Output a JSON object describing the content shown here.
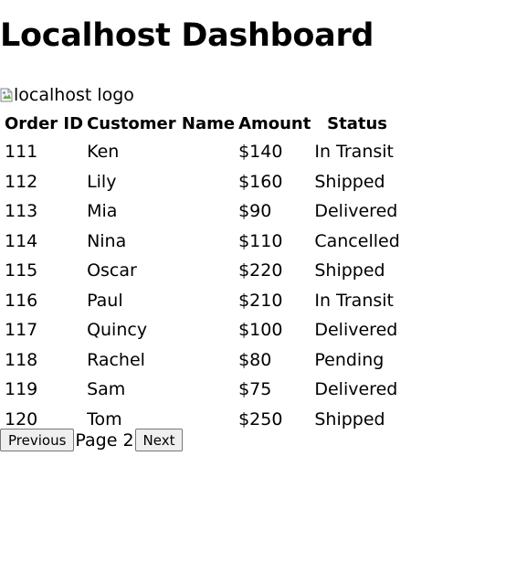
{
  "header": {
    "title": "Localhost Dashboard"
  },
  "logo": {
    "alt": "localhost logo",
    "icon": "broken-image-icon"
  },
  "table": {
    "columns": [
      "Order ID",
      "Customer Name",
      "Amount",
      "Status"
    ],
    "rows": [
      {
        "id": "111",
        "name": "Ken",
        "amount": "$140",
        "status": "In Transit"
      },
      {
        "id": "112",
        "name": "Lily",
        "amount": "$160",
        "status": "Shipped"
      },
      {
        "id": "113",
        "name": "Mia",
        "amount": "$90",
        "status": "Delivered"
      },
      {
        "id": "114",
        "name": "Nina",
        "amount": "$110",
        "status": "Cancelled"
      },
      {
        "id": "115",
        "name": "Oscar",
        "amount": "$220",
        "status": "Shipped"
      },
      {
        "id": "116",
        "name": "Paul",
        "amount": "$210",
        "status": "In Transit"
      },
      {
        "id": "117",
        "name": "Quincy",
        "amount": "$100",
        "status": "Delivered"
      },
      {
        "id": "118",
        "name": "Rachel",
        "amount": "$80",
        "status": "Pending"
      },
      {
        "id": "119",
        "name": "Sam",
        "amount": "$75",
        "status": "Delivered"
      },
      {
        "id": "120",
        "name": "Tom",
        "amount": "$250",
        "status": "Shipped"
      }
    ]
  },
  "pagination": {
    "previous_label": "Previous",
    "page_label": "Page 2",
    "next_label": "Next"
  }
}
